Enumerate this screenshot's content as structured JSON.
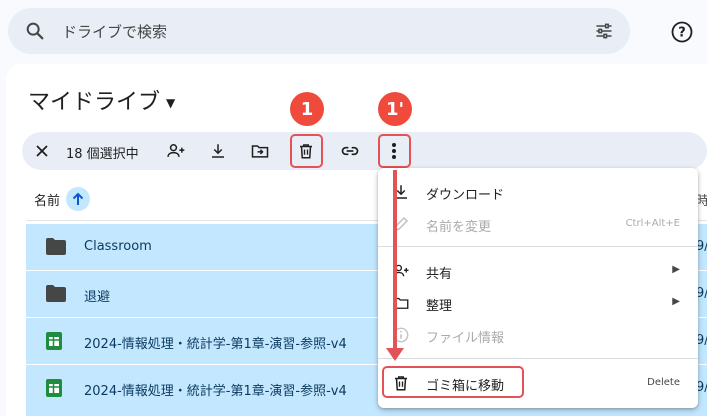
{
  "search": {
    "placeholder": "ドライブで検索"
  },
  "drive": {
    "title": "マイドライブ"
  },
  "actionbar": {
    "count_label": "18 個選択中"
  },
  "badges": {
    "first": "1",
    "second": "1'"
  },
  "columns": {
    "name": "名前",
    "right_partial": "時"
  },
  "rows": [
    {
      "name": "Classroom",
      "icon": "folder-icon",
      "trail": "9/"
    },
    {
      "name": "退避",
      "icon": "folder-icon",
      "trail": "9/"
    },
    {
      "name": "2024-情報処理・統計学-第1章-演習-参照-v4",
      "icon": "sheets-icon",
      "trail": "9/"
    },
    {
      "name": "2024-情報処理・統計学-第1章-演習-参照-v4",
      "icon": "sheets-icon",
      "trail": "9/"
    }
  ],
  "menu": {
    "download": "ダウンロード",
    "rename": "名前を変更",
    "rename_shortcut": "Ctrl+Alt+E",
    "share": "共有",
    "organize": "整理",
    "file_info": "ファイル情報",
    "trash": "ゴミ箱に移動",
    "trash_shortcut": "Delete"
  },
  "colors": {
    "highlight": "#e35256",
    "badge": "#ef4a3c",
    "selection": "#c2e7ff",
    "accent": "#0b57d0"
  }
}
